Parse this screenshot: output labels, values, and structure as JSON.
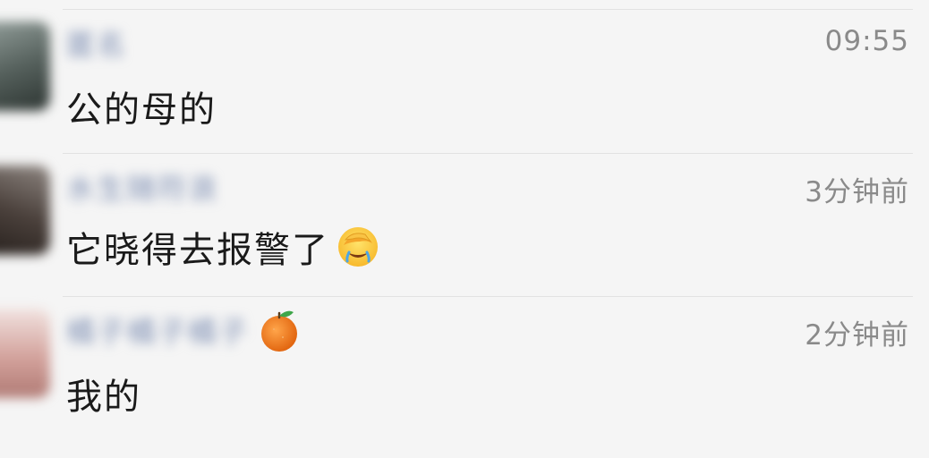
{
  "comments": [
    {
      "name": "匿名",
      "time": "09:55",
      "message": "公的母的",
      "avatar_color": "#66726e"
    },
    {
      "name": "水生随符浪",
      "time": "3分钟前",
      "message": "它晓得去报警了",
      "message_emoji": "facepalm-laughing-emoji",
      "avatar_color": "#4e4642"
    },
    {
      "name": "橘子橘子橘子",
      "name_emoji": "tangerine-emoji",
      "time": "2分钟前",
      "message": "我的",
      "avatar_color": "#d8a8a2"
    }
  ]
}
